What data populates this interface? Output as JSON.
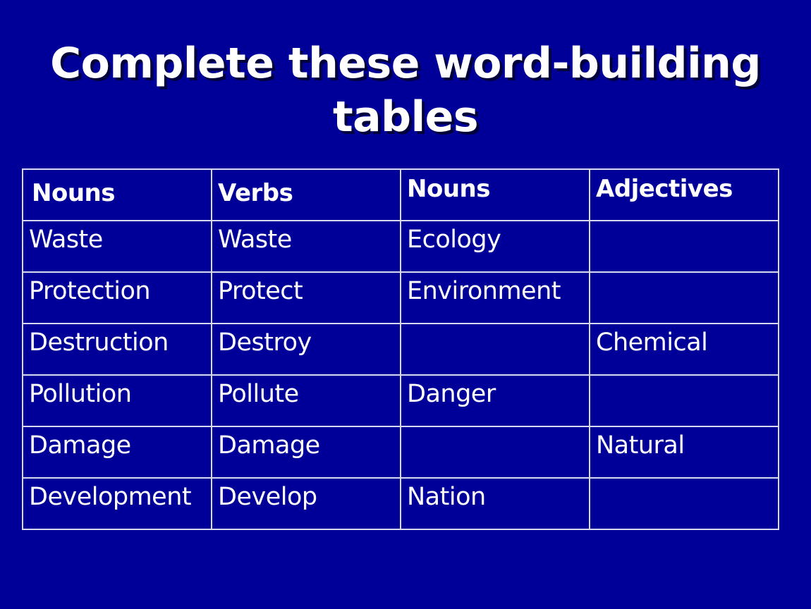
{
  "slide": {
    "title_line1": "Complete these word-building",
    "title_line2": "tables",
    "background_color": "#000099",
    "text_color": "#ffffff"
  },
  "table": {
    "headers": [
      "Nouns",
      "Verbs",
      "Nouns",
      "Adjectives"
    ],
    "rows": [
      [
        "Waste",
        "Waste",
        "Ecology",
        ""
      ],
      [
        "Protection",
        "Protect",
        "Environment",
        ""
      ],
      [
        "Destruction",
        "Destroy",
        "",
        "Chemical"
      ],
      [
        "Pollution",
        "Pollute",
        "Danger",
        ""
      ],
      [
        "Damage",
        "Damage",
        "",
        "Natural"
      ],
      [
        "Development",
        "Develop",
        "Nation",
        ""
      ]
    ]
  }
}
